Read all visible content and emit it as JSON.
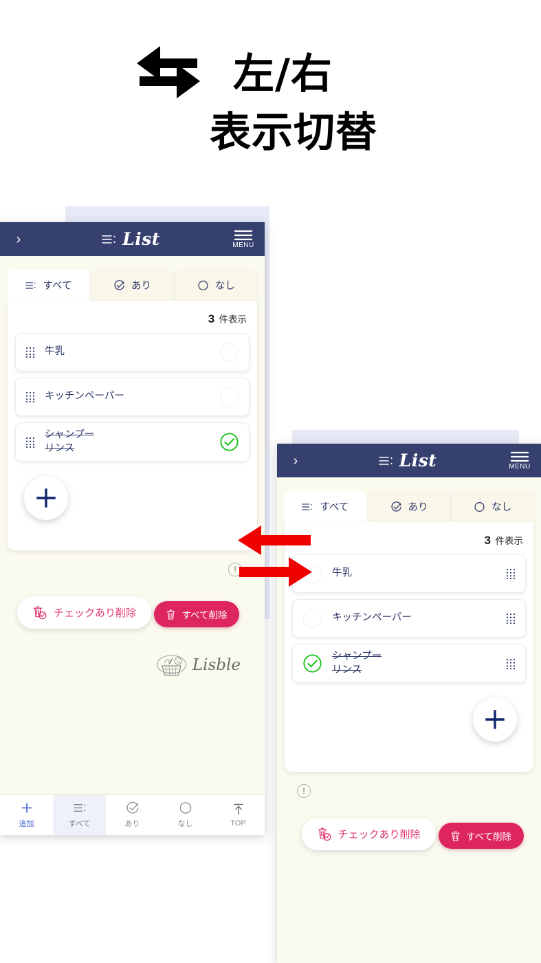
{
  "caption": {
    "icon": "swap-horizontal-icon",
    "line1": "左/右",
    "line2": "表示切替"
  },
  "colors": {
    "appbar_navy": "#36406f",
    "background_cream": "#fbfaef",
    "paper_lavender": "#e7eaf6",
    "accent_pink": "#dd2560",
    "accent_pink_light": "#e0376d",
    "check_green": "#22c522",
    "nav_active_blue": "#3b5fd0",
    "text_navy": "#2c3668",
    "arrow_red": "#ee0000"
  },
  "app": {
    "appbar": {
      "back_chevron": "›",
      "title": "List",
      "title_icon": "list-lines-icon",
      "menu_icon": "hamburger-menu-icon",
      "menu_label": "MENU"
    },
    "tabs": [
      {
        "id": "all",
        "label": "すべて",
        "icon": "list-lines-icon",
        "active": true
      },
      {
        "id": "checked",
        "label": "あり",
        "icon": "check-circle-icon",
        "active": false
      },
      {
        "id": "none",
        "label": "なし",
        "icon": "circle-icon",
        "active": false
      }
    ],
    "count": {
      "number": "3",
      "unit": "件表示"
    },
    "items": [
      {
        "label": "牛乳",
        "checked": false
      },
      {
        "label": "キッチンペーパー",
        "checked": false
      },
      {
        "label": "シャンプー\nリンス",
        "checked": true
      }
    ],
    "fab": {
      "icon": "plus-icon",
      "label": "+"
    },
    "info_icon": "info-exclamation-icon",
    "buttons": {
      "delete_checked": {
        "label": "チェックあり削除",
        "icon": "trash-check-icon"
      },
      "delete_all": {
        "label": "すべて削除",
        "icon": "trash-icon"
      }
    },
    "brand": {
      "word": "Lisble",
      "icon": "shopping-basket-icon"
    },
    "bottom_nav": [
      {
        "id": "add",
        "label": "追加",
        "icon": "plus-icon",
        "state": "accent"
      },
      {
        "id": "all",
        "label": "すべて",
        "icon": "list-lines-icon",
        "state": "selected"
      },
      {
        "id": "ari",
        "label": "あり",
        "icon": "check-circle-icon",
        "state": "normal"
      },
      {
        "id": "nasi",
        "label": "なし",
        "icon": "circle-icon",
        "state": "normal"
      },
      {
        "id": "top",
        "label": "TOP",
        "icon": "arrow-up-bar-icon",
        "state": "normal"
      }
    ]
  },
  "arrows": {
    "left_arrow_icon": "arrow-left-icon",
    "right_arrow_icon": "arrow-right-icon"
  }
}
